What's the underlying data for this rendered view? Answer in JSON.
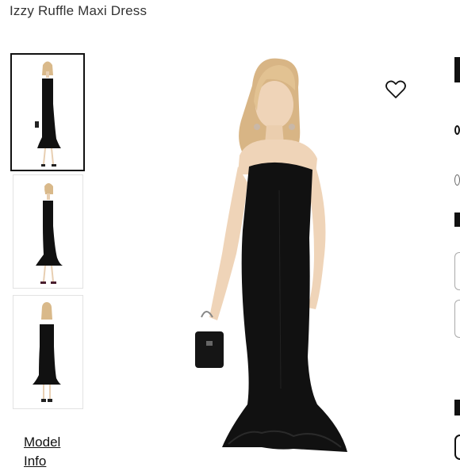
{
  "product": {
    "title": "Izzy Ruffle Maxi Dress"
  },
  "gallery": {
    "thumbnails": [
      {
        "view": "front",
        "selected": true
      },
      {
        "view": "side",
        "selected": false
      },
      {
        "view": "back",
        "selected": false
      }
    ],
    "model_info_label": "Model Info"
  },
  "icons": {
    "favorite": "heart-icon"
  },
  "colors": {
    "dress": "#111111",
    "selected_border": "#111111",
    "accent": "#c2188b"
  }
}
